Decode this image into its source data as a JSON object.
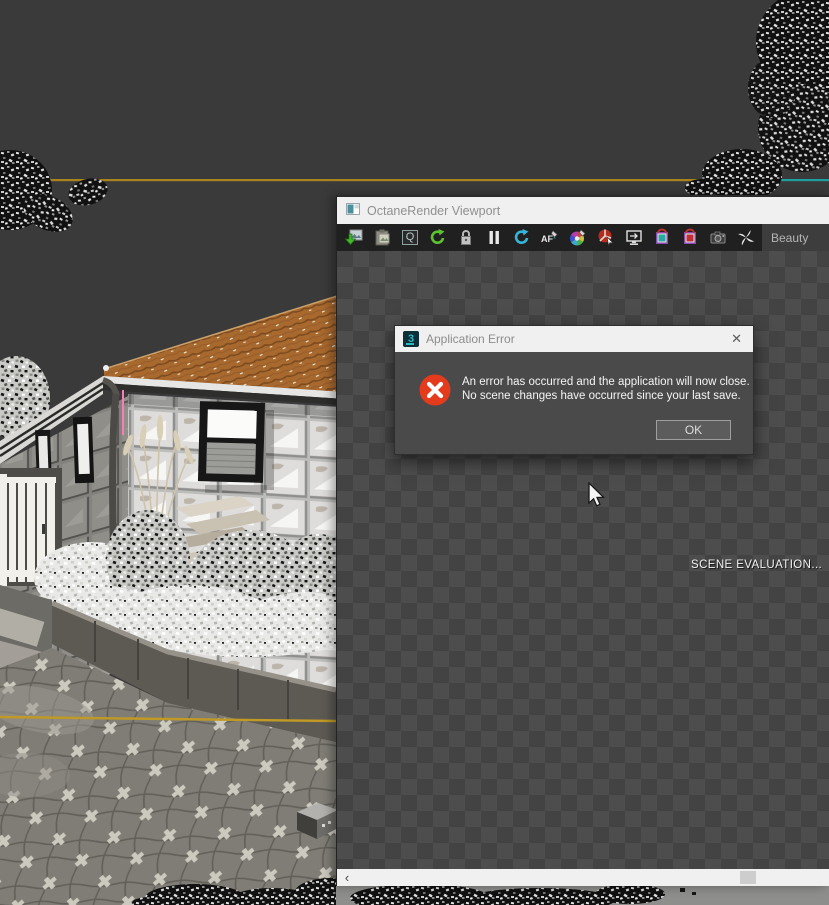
{
  "window": {
    "title": "OctaneRender Viewport",
    "toolbar": {
      "icons": [
        {
          "name": "save-render-image"
        },
        {
          "name": "copy-to-clipboard"
        },
        {
          "name": "quick-save"
        },
        {
          "name": "restart-render-green"
        },
        {
          "name": "lock-resolution"
        },
        {
          "name": "pause-render"
        },
        {
          "name": "refresh-render-blue"
        },
        {
          "name": "autofocus"
        },
        {
          "name": "white-balance-picker"
        },
        {
          "name": "render-priority"
        },
        {
          "name": "fit-to-viewport"
        },
        {
          "name": "render-bucket-teal"
        },
        {
          "name": "render-bucket-red"
        },
        {
          "name": "camera-settings"
        },
        {
          "name": "octane-logo"
        }
      ],
      "q_label": "Q",
      "af_label": "AF",
      "pass_value": "Beauty"
    },
    "status_text": "SCENE EVALUATION...",
    "scrollbar": {
      "left_arrow": "‹"
    }
  },
  "dialog": {
    "title": "Application Error",
    "app_icon_label": "3",
    "close_label": "✕",
    "message_line1": "An error has occurred and the application will now close.",
    "message_line2": "No scene changes have occurred since your last save.",
    "ok_label": "OK"
  },
  "colors": {
    "horizon_yellow": "#a9831d",
    "horizon_teal": "#1f9fa0",
    "selection_pink": "#ff7ab8",
    "error_red": "#e33b1c",
    "roof_terracotta": "#a8692f",
    "checker_dark": "#434343",
    "checker_light": "#4d4d4d",
    "titlebar_bg": "#f0f0f0",
    "toolbar_bg": "#202020",
    "dialog_body_bg": "#4a4a4a"
  }
}
